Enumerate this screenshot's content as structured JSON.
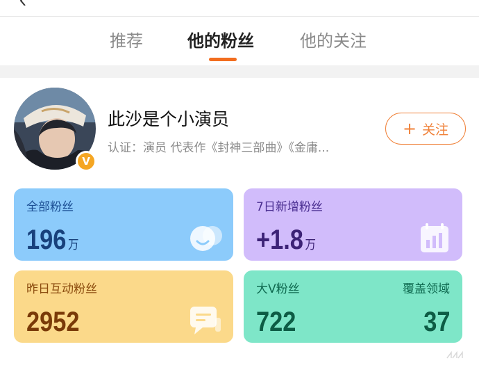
{
  "tabs": [
    {
      "label": "推荐"
    },
    {
      "label": "他的粉丝"
    },
    {
      "label": "他的关注"
    }
  ],
  "active_tab": "他的粉丝",
  "profile": {
    "name": "此沙是个小演员",
    "certification": "认证：演员 代表作《封神三部曲》《金庸...",
    "follow_label": "关注",
    "verified": true
  },
  "stats": {
    "total_fans": {
      "label": "全部粉丝",
      "value": "196",
      "unit": "万"
    },
    "new_fans_7d": {
      "label": "7日新增粉丝",
      "value": "+1.8",
      "unit": "万"
    },
    "interactive_fans_yesterday": {
      "label": "昨日互动粉丝",
      "value": "2952"
    },
    "big_v_fans": {
      "label": "大V粉丝",
      "value": "722",
      "coverage_label": "覆盖领域",
      "coverage_value": "37"
    }
  },
  "colors": {
    "accent": "#f26d1f",
    "card_total": "#8ccbfb",
    "card_new": "#d1bcfb",
    "card_interactive": "#fbd98a",
    "card_bigv": "#7ee6c8"
  }
}
